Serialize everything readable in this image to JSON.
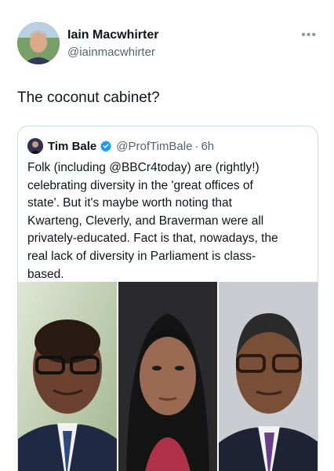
{
  "author": {
    "name": "Iain Macwhirter",
    "handle": "@iainmacwhirter",
    "avatar_icon": "profile-photo"
  },
  "more_icon": "more-dots-icon",
  "tweet_text": "The coconut cabinet?",
  "quote": {
    "name": "Tim Bale",
    "handle": "@ProfTimBale",
    "dot": "·",
    "time": "6h",
    "verified_color": "#1d9bf0",
    "lines": [
      "Folk (including @BBCr4today) are (rightly!)",
      "celebrating diversity in the 'great offices of",
      "state'. But it's maybe worth noting that",
      "Kwarteng, Cleverly, and Braverman were all",
      "privately-educated. Fact is that, nowadays, the",
      "real lack of diversity in Parliament is class-",
      "based."
    ],
    "photos": [
      "man-glasses-blue-tie",
      "woman-dark-hair",
      "man-glasses-purple-tie"
    ]
  }
}
